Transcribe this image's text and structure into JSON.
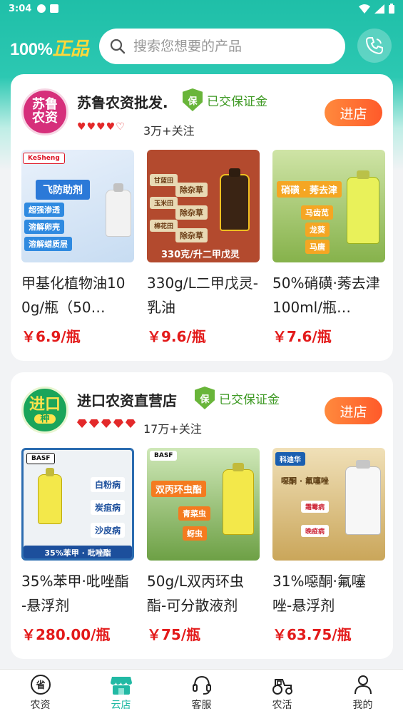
{
  "status_bar": {
    "time": "3:04"
  },
  "header": {
    "brand_prefix": "100%",
    "brand_suffix": "正品",
    "search_placeholder": "搜索您想要的产品"
  },
  "shops": [
    {
      "logo_line1": "苏鲁",
      "logo_line2": "农资",
      "name": "苏鲁农资批发.",
      "badge": "已交保证金",
      "badge_mark": "保",
      "followers": "3万+关注",
      "enter_label": "进店",
      "products": [
        {
          "name": "甲基化植物油100g/瓶（50…",
          "price": "￥6.9/瓶",
          "image_text": [
            "飞防助剂",
            "超强渗透",
            "溶解卵壳",
            "溶解蜡质层"
          ],
          "brand_mark": "KeSheng"
        },
        {
          "name": "330g/L二甲戊灵-乳油",
          "price": "￥9.6/瓶",
          "image_text": [
            "甘蓝田",
            "除杂草",
            "玉米田",
            "除杂草",
            "棉花田",
            "除杂草",
            "330克/升二甲戊灵"
          ]
        },
        {
          "name": "50%硝磺·莠去津100ml/瓶…",
          "price": "￥7.6/瓶",
          "image_text": [
            "硝磺 · 莠去津",
            "马齿苋",
            "龙葵",
            "马唐"
          ]
        }
      ]
    },
    {
      "logo_line1": "进口",
      "logo_line2": "种",
      "name": "进口农资直营店",
      "badge": "已交保证金",
      "badge_mark": "保",
      "followers": "17万+关注",
      "enter_label": "进店",
      "products": [
        {
          "name": "35%苯甲·吡唑酯 -悬浮剂",
          "price": "￥280.00/瓶",
          "image_text": [
            "BASF",
            "白粉病",
            "炭疽病",
            "沙皮病",
            "35%苯甲 · 吡唑酯"
          ]
        },
        {
          "name": "50g/L双丙环虫酯-可分散液剂",
          "price": "￥75/瓶",
          "image_text": [
            "BASF",
            "双丙环虫酯",
            "青菜虫",
            "蚜虫"
          ]
        },
        {
          "name": "31%噁酮·氟噻唑-悬浮剂",
          "price": "￥63.75/瓶",
          "image_text": [
            "科迪华",
            "噁酮 · 氟噻唑",
            "霜霉病",
            "晚疫病"
          ]
        }
      ]
    }
  ],
  "tabs": [
    {
      "label": "农资",
      "icon": "province-icon"
    },
    {
      "label": "云店",
      "icon": "store-icon",
      "active": true
    },
    {
      "label": "客服",
      "icon": "headset-icon"
    },
    {
      "label": "农活",
      "icon": "tractor-icon"
    },
    {
      "label": "我的",
      "icon": "user-icon"
    }
  ],
  "colors": {
    "accent": "#21b9a4",
    "price": "#e31a1a",
    "enter_button": "#ff6a30",
    "badge": "#3f9a25"
  }
}
